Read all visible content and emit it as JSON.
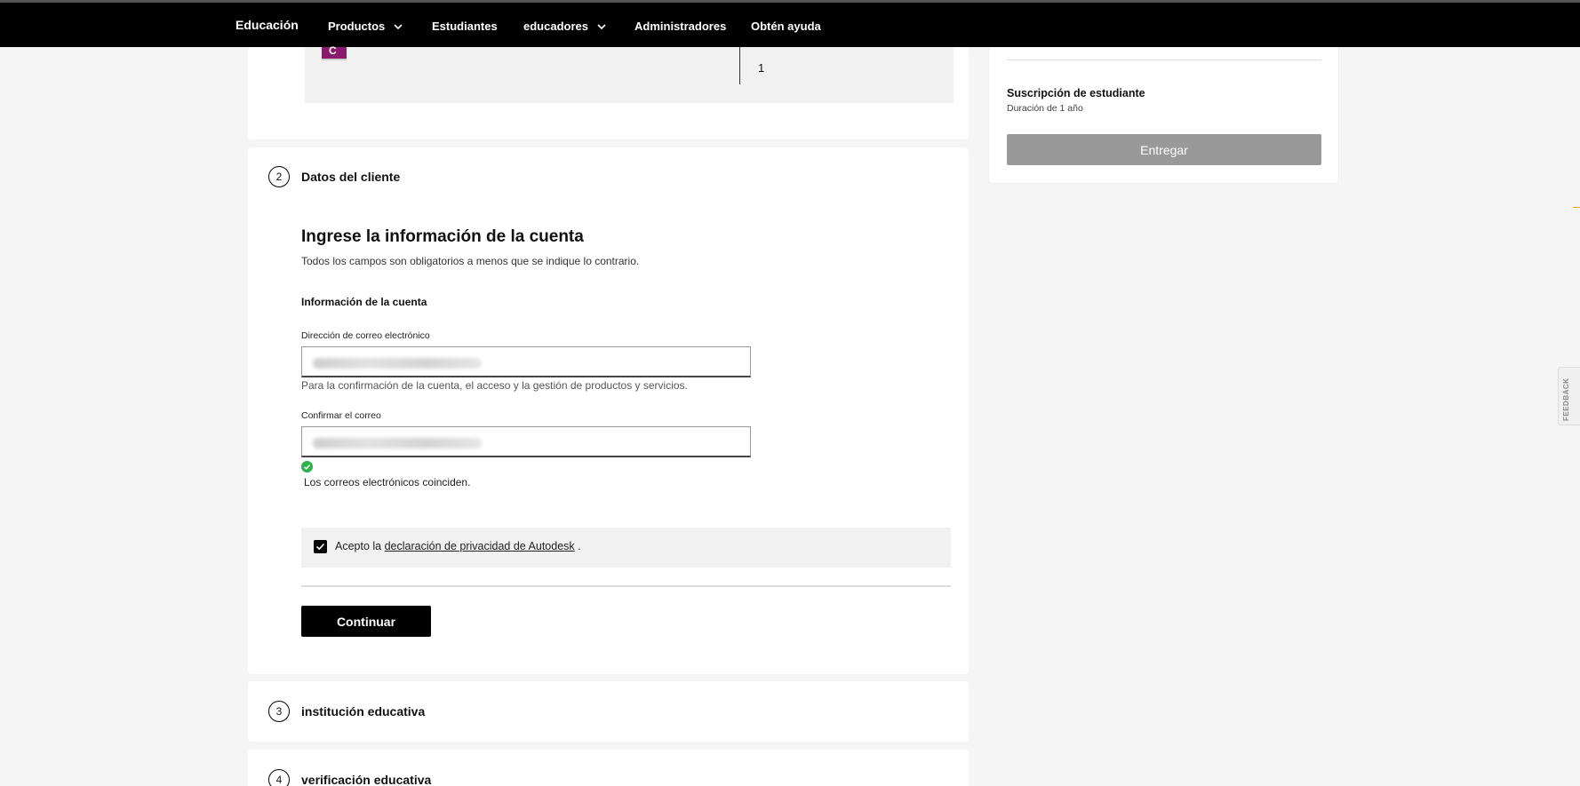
{
  "nav": {
    "brand": "Educación",
    "items": [
      {
        "label": "Productos",
        "has_dropdown": true
      },
      {
        "label": "Estudiantes",
        "has_dropdown": false
      },
      {
        "label": "educadores",
        "has_dropdown": true
      },
      {
        "label": "Administradores",
        "has_dropdown": false
      },
      {
        "label": "Obtén ayuda",
        "has_dropdown": false
      }
    ]
  },
  "product": {
    "quantity": "1",
    "icon": "product-app-icon"
  },
  "steps": [
    {
      "number": "2",
      "title": "Datos del cliente"
    },
    {
      "number": "3",
      "title": "institución educativa"
    },
    {
      "number": "4",
      "title": "verificación educativa"
    }
  ],
  "form": {
    "heading": "Ingrese la información de la cuenta",
    "subheading": "Todos los campos son obligatorios a menos que se indique lo contrario.",
    "section": "Información de la cuenta",
    "email_label": "Dirección de correo electrónico",
    "email_hint": "Para la confirmación de la cuenta, el acceso y la gestión de productos y servicios.",
    "confirm_label": "Confirmar el correo",
    "match_message": "Los correos electrónicos coinciden.",
    "consent_prefix": "Acepto la",
    "consent_link": "declaración de privacidad de Autodesk",
    "consent_suffix": ".",
    "consent_checked": true,
    "continue_label": "Continuar"
  },
  "summary": {
    "title": "Suscripción de estudiante",
    "duration": "Duración de 1 año",
    "submit_label": "Entregar",
    "submit_enabled": false
  },
  "feedback_tab": "FEEDBACK",
  "colors": {
    "nav_bg": "#000000",
    "primary_button": "#000000",
    "disabled_button": "#999999",
    "success": "#2db34a",
    "product_icon": "#8a1a6a"
  }
}
